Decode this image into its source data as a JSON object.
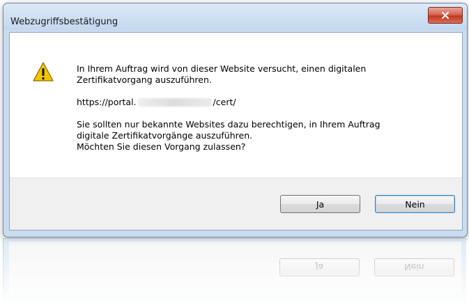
{
  "window": {
    "title": "Webzugriffsbestätigung",
    "close_icon": "close-icon"
  },
  "message": {
    "icon": "warning-icon",
    "line1": "In Ihrem Auftrag wird von dieser Website versucht, einen digitalen",
    "line2": "Zertifikatvorgang auszuführen.",
    "url_prefix": "https://portal.",
    "url_suffix": "/cert/",
    "line3": "Sie sollten nur bekannte Websites dazu berechtigen, in Ihrem Auftrag",
    "line4": "digitale Zertifikatvorgänge auszuführen.",
    "line5": "Möchten Sie diesen Vorgang zulassen?"
  },
  "buttons": {
    "yes": "Ja",
    "no": "Nein"
  },
  "colors": {
    "titlebar": "#c9dcef",
    "close": "#c0391f",
    "warning": "#f5c400",
    "default_button_border": "#3c7fb1"
  }
}
